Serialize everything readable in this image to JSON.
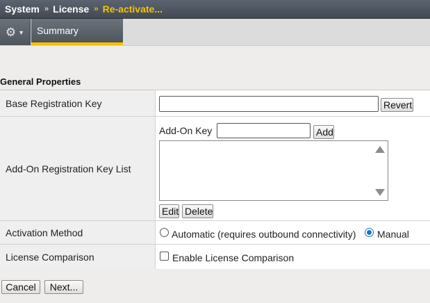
{
  "breadcrumb": {
    "items": [
      "System",
      "License",
      "Re-activate..."
    ],
    "separator": "››"
  },
  "tabs": {
    "gear_icon": "gear-icon",
    "summary_label": "Summary"
  },
  "section": {
    "title": "General Properties"
  },
  "properties": {
    "base_key": {
      "label": "Base Registration Key",
      "value": "",
      "revert_label": "Revert"
    },
    "addon": {
      "label": "Add-On Registration Key List",
      "addon_key_label": "Add-On Key",
      "addon_key_value": "",
      "add_label": "Add",
      "list_items": [],
      "edit_label": "Edit",
      "delete_label": "Delete"
    },
    "activation": {
      "label": "Activation Method",
      "options": [
        "Automatic (requires outbound connectivity)",
        "Manual"
      ],
      "selected": "Manual"
    },
    "comparison": {
      "label": "License Comparison",
      "checkbox_label": "Enable License Comparison",
      "checked": false
    }
  },
  "footer": {
    "cancel_label": "Cancel",
    "next_label": "Next..."
  },
  "colors": {
    "accent": "#f5c200",
    "radio_selected": "#1a73c8",
    "header_bg": "#4f555d"
  }
}
